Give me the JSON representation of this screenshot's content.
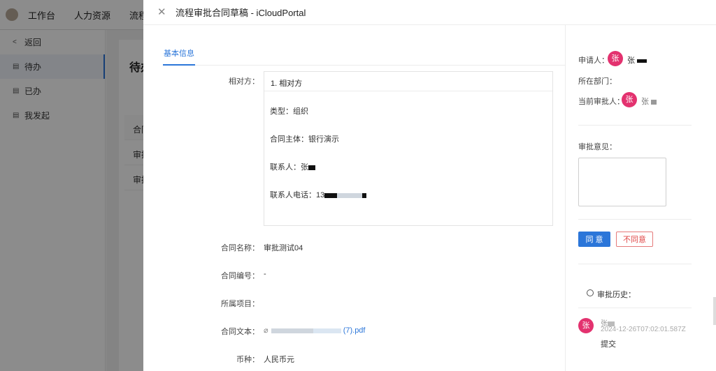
{
  "background": {
    "nav": [
      "工作台",
      "人力资源",
      "流程管"
    ],
    "sidebar": [
      {
        "icon": "chevron-left-icon",
        "label": "返回"
      },
      {
        "icon": "inbox-icon",
        "label": "待办"
      },
      {
        "icon": "inbox-icon",
        "label": "已办"
      },
      {
        "icon": "inbox-icon",
        "label": "我发起"
      }
    ],
    "page_title": "待办",
    "table_header": "合同",
    "table_rows": [
      "审批",
      "审批"
    ]
  },
  "drawer": {
    "title": "流程审批合同草稿 - iCloudPortal",
    "tab": "基本信息",
    "counterparty": {
      "label": "相对方：",
      "header": "1. 相对方",
      "type_label": "类型：",
      "type_value": "组织",
      "entity_label": "合同主体：",
      "entity_value": "银行演示",
      "contact_label": "联系人：",
      "contact_value": "张",
      "phone_label": "联系人电话：",
      "phone_value": "13"
    },
    "fields": [
      {
        "label": "合同名称：",
        "value": "审批测试04"
      },
      {
        "label": "合同编号：",
        "value": "-"
      },
      {
        "label": "所属项目：",
        "value": ""
      },
      {
        "label": "合同文本：",
        "value": "(7).pdf"
      },
      {
        "label": "币种：",
        "value": "人民币元"
      }
    ],
    "right": {
      "applicant_label": "申请人：",
      "applicant_avatar": "张",
      "applicant_name": "张",
      "dept_label": "所在部门：",
      "approver_label": "当前审批人：",
      "approver_avatar": "张",
      "approver_name": "张",
      "opinion_label": "审批意见：",
      "agree": "同 意",
      "reject": "不同意",
      "history_title": "审批历史：",
      "history": [
        {
          "avatar": "张",
          "user": "张",
          "time": "2024-12-26T07:02:01.587Z",
          "action": "提交"
        }
      ]
    }
  },
  "colors": {
    "accent": "#2b76d9",
    "avatar": "#e3326f",
    "danger": "#e04848"
  }
}
